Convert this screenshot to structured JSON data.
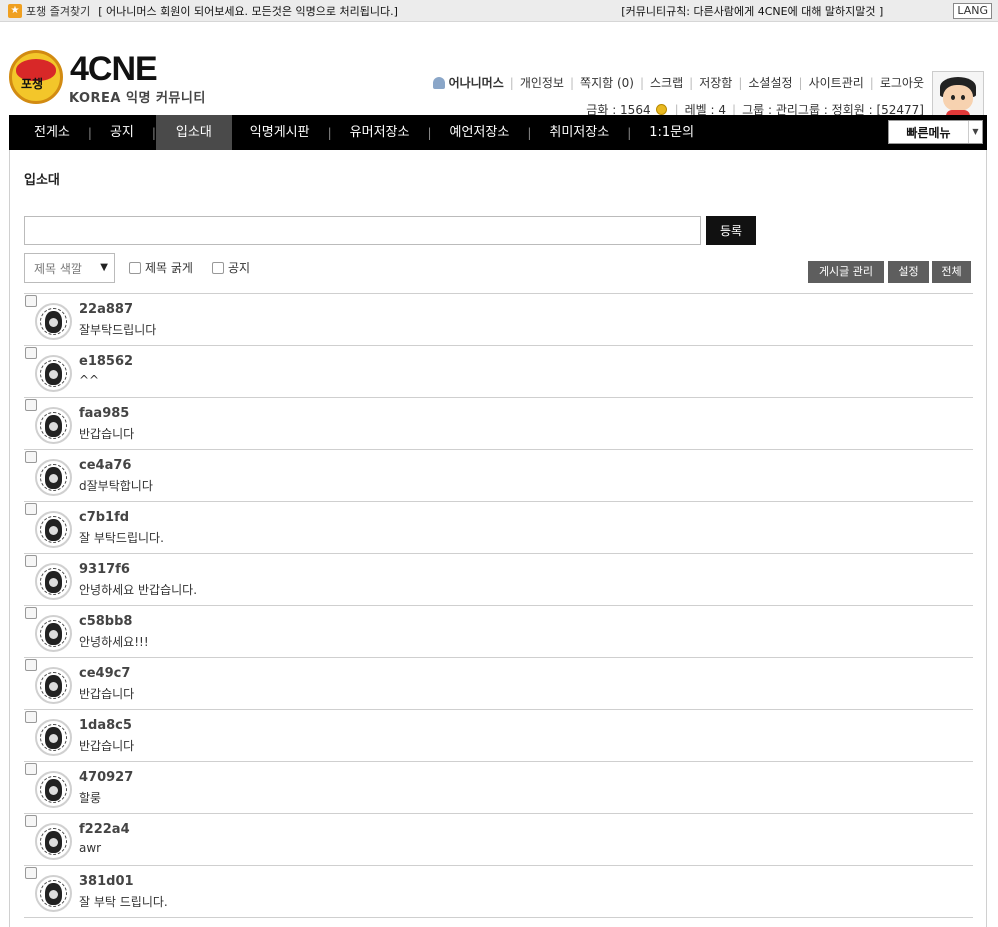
{
  "topbar": {
    "favorite_label": "포챙 즐겨찾기",
    "notice": "[ 어나니머스 회원이 되어보세요. 모든것은 익명으로 처리됩니다.]",
    "rule": "[커뮤니티규칙: 다른사람에게 4CNE에 대해 말하지말것 ]",
    "lang": "LANG"
  },
  "logo": {
    "emblem_text": "포챙",
    "title": "4CNE",
    "subtitle": "KOREA 익명 커뮤니티"
  },
  "user_menu": {
    "username": "어나니머스",
    "links": [
      "개인정보",
      "쪽지함 (0)",
      "스크랩",
      "저장함",
      "소셜설정",
      "사이트관리",
      "로그아웃"
    ]
  },
  "user_stats": {
    "gold": "금화 : 1564",
    "level": "레벨 : 4",
    "group": "그룹 : 관리그룹 : 정회원 : [52477]"
  },
  "nav": {
    "items": [
      "전게소",
      "공지",
      "입소대",
      "익명게시판",
      "유머저장소",
      "예언저장소",
      "취미저장소",
      "1:1문의"
    ],
    "active_index": 2,
    "quick_menu": "빠른메뉴"
  },
  "page": {
    "title": "입소대",
    "input_value": "",
    "submit_label": "등록",
    "color_select": "제목 색깔",
    "bold_label": "제목 굵게",
    "notice_label": "공지",
    "manage_label": "게시글 관리",
    "settings_label": "설정",
    "all_label": "전체"
  },
  "posts": [
    {
      "name": "22a887",
      "message": "잘부탁드립니다"
    },
    {
      "name": "e18562",
      "message": "^^"
    },
    {
      "name": "faa985",
      "message": "반갑습니다"
    },
    {
      "name": "ce4a76",
      "message": "d잘부탁합니다"
    },
    {
      "name": "c7b1fd",
      "message": "잘 부탁드립니다."
    },
    {
      "name": "9317f6",
      "message": "안녕하세요 반갑습니다."
    },
    {
      "name": "c58bb8",
      "message": "안녕하세요!!!"
    },
    {
      "name": "ce49c7",
      "message": "반갑습니다"
    },
    {
      "name": "1da8c5",
      "message": "반갑습니다"
    },
    {
      "name": "470927",
      "message": "할룽"
    },
    {
      "name": "f222a4",
      "message": "awr"
    },
    {
      "name": "381d01",
      "message": "잘 부탁 드립니다."
    }
  ]
}
